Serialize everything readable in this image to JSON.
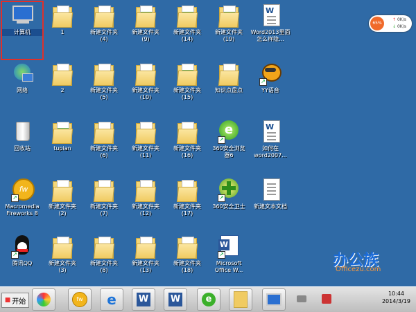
{
  "desktop": {
    "icons": [
      {
        "label": "计算机"
      },
      {
        "label": "网络"
      },
      {
        "label": "回收站"
      },
      {
        "label": "Macromedia\nFireworks 8"
      },
      {
        "label": "腾讯QQ"
      },
      {
        "label": "1"
      },
      {
        "label": "2"
      },
      {
        "label": "tupian"
      },
      {
        "label": "新建文件夹\n(2)"
      },
      {
        "label": "新建文件夹\n(3)"
      },
      {
        "label": "新建文件夹\n(4)"
      },
      {
        "label": "新建文件夹\n(5)"
      },
      {
        "label": "新建文件夹\n(6)"
      },
      {
        "label": "新建文件夹\n(7)"
      },
      {
        "label": "新建文件夹\n(8)"
      },
      {
        "label": "新建文件夹\n(9)"
      },
      {
        "label": "新建文件夹\n(10)"
      },
      {
        "label": "新建文件夹\n(11)"
      },
      {
        "label": "新建文件夹\n(12)"
      },
      {
        "label": "新建文件夹\n(13)"
      },
      {
        "label": "新建文件夹\n(14)"
      },
      {
        "label": "新建文件夹\n(15)"
      },
      {
        "label": "新建文件夹\n(16)"
      },
      {
        "label": "新建文件夹\n(17)"
      },
      {
        "label": "新建文件夹\n(18)"
      },
      {
        "label": "新建文件夹\n(19)"
      },
      {
        "label": "知识点盘点"
      },
      {
        "label": "360安全浏览\n器6"
      },
      {
        "label": "360安全卫士"
      },
      {
        "label": "Microsoft\nOffice W..."
      },
      {
        "label": "Word2013里面\n怎么样隐..."
      },
      {
        "label": "YY语音"
      },
      {
        "label": "如何在\nword2007..."
      },
      {
        "label": "新建文本文档"
      }
    ]
  },
  "widget": {
    "percent": "65%",
    "up": "0K/s",
    "down": "0K/s"
  },
  "taskbar": {
    "start_label": "开始",
    "clock_time": "10:44",
    "clock_date": "2014/3/19"
  },
  "watermark": {
    "brand": "办公族",
    "site": "Officezu.com"
  },
  "colors": {
    "desktop": "#2f6aa6",
    "selection_outline": "#e0302a"
  }
}
